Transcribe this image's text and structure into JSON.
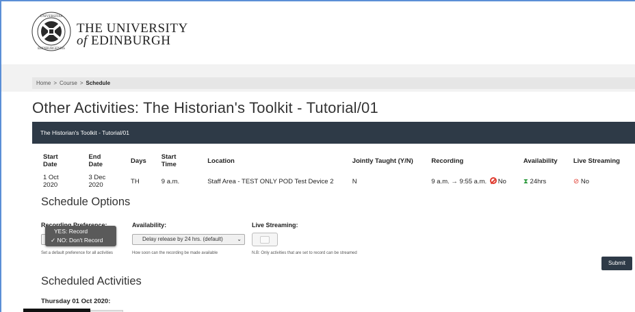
{
  "header": {
    "name_line1": "THE UNIVERSITY",
    "name_line2_of": "of",
    "name_line2": "EDINBURGH"
  },
  "breadcrumb": {
    "home": "Home",
    "course": "Course",
    "current": "Schedule",
    "sep": ">"
  },
  "page_title": "Other Activities: The Historian's Toolkit - Tutorial/01",
  "panel_title": "The Historian's Toolkit - Tutorial/01",
  "table": {
    "headers": [
      "Start Date",
      "End Date",
      "Days",
      "Start Time",
      "Location",
      "Jointly Taught (Y/N)",
      "Recording",
      "Availability",
      "Live Streaming"
    ],
    "row": {
      "start_date": "1 Oct 2020",
      "end_date": "3 Dec 2020",
      "days": "TH",
      "start_time": "9 a.m.",
      "location": "Staff Area - TEST ONLY POD Test Device 2",
      "jointly_taught": "N",
      "recording_time": "9 a.m. → 9:55 a.m.",
      "recording_value": "No",
      "availability": "24hrs",
      "live_streaming": "No"
    }
  },
  "schedule_options": {
    "heading": "Schedule Options",
    "recording_label": "Recording Preference:",
    "recording_options": [
      "YES: Record",
      "✓ NO: Don't Record"
    ],
    "recording_help": "Set a default preference for all activities",
    "availability_label": "Availability:",
    "availability_value": "Delay release by 24 hrs. (default)",
    "availability_help": "How soon can the recording be made available",
    "live_label": "Live Streaming:",
    "live_help": "N.B: Only activities that are set to record can be streamed",
    "submit_label": "Submit"
  },
  "scheduled_activities": {
    "heading": "Scheduled Activities",
    "day_label": "Thursday 01 Oct 2020:"
  },
  "colors": {
    "dark_bar": "#2e3a47",
    "no_red": "#e03a2e",
    "available_green": "#2e9b3e",
    "window_border": "#5b8fd6"
  },
  "icons": {
    "recording_no": "no-entry-icon",
    "availability": "hourglass-icon",
    "live_streaming": "video-off-icon",
    "dropdown": "chevron-down-icon"
  }
}
